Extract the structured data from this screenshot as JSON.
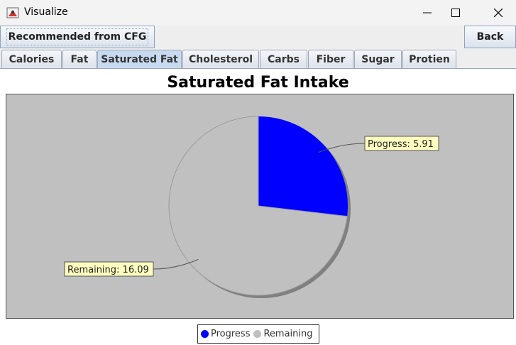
{
  "window": {
    "title": "Visualize",
    "icon": "java-app-icon"
  },
  "toolbar": {
    "recommended_label": "Recommended from CFG",
    "back_label": "Back"
  },
  "tabs": [
    {
      "label": "Calories",
      "active": false
    },
    {
      "label": "Fat",
      "active": false
    },
    {
      "label": "Saturated Fat",
      "active": true
    },
    {
      "label": "Cholesterol",
      "active": false
    },
    {
      "label": "Carbs",
      "active": false
    },
    {
      "label": "Fiber",
      "active": false
    },
    {
      "label": "Sugar",
      "active": false
    },
    {
      "label": "Protien",
      "active": false
    }
  ],
  "chart_data": {
    "type": "pie",
    "title": "Saturated Fat Intake",
    "categories": [
      "Progress",
      "Remaining"
    ],
    "values": [
      5.91,
      16.09
    ],
    "colors": [
      "#0000ff",
      "#c0c0c0"
    ],
    "labels": [
      "Progress: 5.91",
      "Remaining: 16.09"
    ],
    "legend": "bottom",
    "background": "#c0c0c0"
  }
}
